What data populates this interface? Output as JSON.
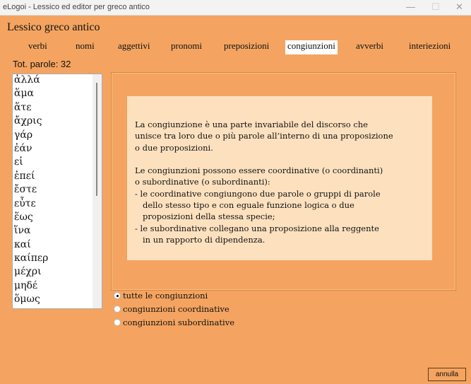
{
  "window": {
    "title": "eLogoi - Lessico ed editor per greco antico",
    "minimize": "—",
    "maximize": "☐",
    "close": "✕"
  },
  "app_title": "Lessico greco antico",
  "tabs": [
    {
      "label": "verbi"
    },
    {
      "label": "nomi"
    },
    {
      "label": "aggettivi"
    },
    {
      "label": "pronomi"
    },
    {
      "label": "preposizioni"
    },
    {
      "label": "congiunzioni",
      "active": true
    },
    {
      "label": "avverbi"
    },
    {
      "label": "interiezioni"
    }
  ],
  "word_count": "Tot. parole: 32",
  "words": [
    "ἀλλά",
    "ἅμα",
    "ἅτε",
    "ἄχρις",
    "γάρ",
    "ἐάν",
    "εἰ",
    "ἐπεί",
    "ἔστε",
    "εὖτε",
    "ἕως",
    "ἵνα",
    "καί",
    "καίπερ",
    "μέχρι",
    "μηδέ",
    "ὅμως"
  ],
  "info_text": "La congiunzione è una parte invariabile del discorso che\nunisce tra loro due o più parole all’interno di una proposizione\no due proposizioni.\n\nLe congiunzioni possono essere coordinative (o coordinanti)\no subordinative (o subordinanti):\n- le coordinative congiungono due parole o gruppi di parole\n   dello stesso tipo e con eguale funzione logica o due\n   proposizioni della stessa specie;\n- le subordinative collegano una proposizione alla reggente\n   in un rapporto di dipendenza.",
  "filters": [
    {
      "label": "tutte le congiunzioni",
      "selected": true
    },
    {
      "label": "congiunzioni coordinative",
      "selected": false
    },
    {
      "label": "congiunzioni subordinative",
      "selected": false
    }
  ],
  "cancel_label": "annulla"
}
